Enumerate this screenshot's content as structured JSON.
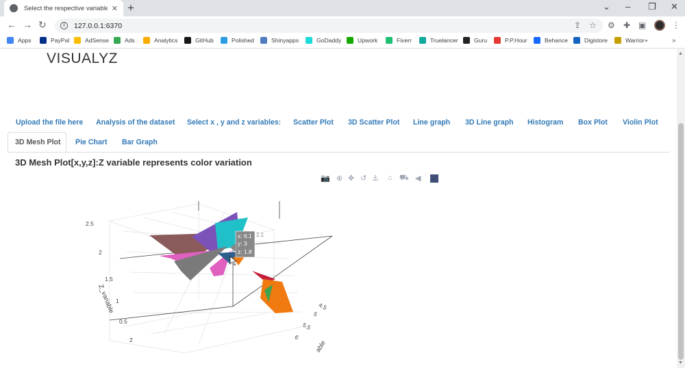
{
  "browser": {
    "tab_title": "Select the respective variables to pl",
    "url": "127.0.0.1:6370",
    "bookmarks": [
      {
        "label": "Apps",
        "icon": "apps-grid-icon",
        "color": "#4285f4"
      },
      {
        "label": "PayPal",
        "icon": "paypal-icon",
        "color": "#003087"
      },
      {
        "label": "AdSense",
        "icon": "adsense-icon",
        "color": "#fbbc04"
      },
      {
        "label": "Ads",
        "icon": "google-ads-icon",
        "color": "#34a853"
      },
      {
        "label": "Analytics",
        "icon": "analytics-icon",
        "color": "#f9ab00"
      },
      {
        "label": "GitHub",
        "icon": "github-icon",
        "color": "#181717"
      },
      {
        "label": "Polished",
        "icon": "polished-icon",
        "color": "#2f9be0"
      },
      {
        "label": "Shinyapps",
        "icon": "shinyapps-icon",
        "color": "#4f7cbf"
      },
      {
        "label": "GoDaddy",
        "icon": "godaddy-icon",
        "color": "#1bdbdb"
      },
      {
        "label": "Upwork",
        "icon": "upwork-icon",
        "color": "#14a800"
      },
      {
        "label": "Fiverr",
        "icon": "fiverr-icon",
        "color": "#1dbf73"
      },
      {
        "label": "Truelancer",
        "icon": "truelancer-icon",
        "color": "#13a89e"
      },
      {
        "label": "Guru",
        "icon": "guru-icon",
        "color": "#222222"
      },
      {
        "label": "P.P.Hour",
        "icon": "pph-icon",
        "color": "#e53935"
      },
      {
        "label": "Behance",
        "icon": "behance-icon",
        "color": "#1769ff"
      },
      {
        "label": "Digistore",
        "icon": "digistore-icon",
        "color": "#1565c0"
      },
      {
        "label": "Warrior+",
        "icon": "warriorplus-icon",
        "color": "#c6a000"
      }
    ],
    "bookmarks_more": "»"
  },
  "app": {
    "brand": "VISUALYZ",
    "tabs": [
      "Upload the file here",
      "Analysis of the dataset",
      "Select x , y and z variables:",
      "Scatter Plot",
      "3D Scatter Plot",
      "Line graph",
      "3D Line graph",
      "Histogram",
      "Box Plot",
      "Violin Plot",
      "3D Mesh Plot",
      "Pie Chart",
      "Bar Graph"
    ],
    "active_tab": "3D Mesh Plot",
    "section_title": "3D Mesh Plot[x,y,z]:Z variable represents color variation"
  },
  "chart_data": {
    "type": "mesh3d",
    "zlabel": "Z_variable",
    "ylabel": "able",
    "z_ticks": [
      "2.5",
      "2",
      "1.5",
      "1",
      "0.5",
      "2"
    ],
    "y_ticks": [
      "4.5",
      "5",
      "5.5",
      "6"
    ],
    "hover": {
      "x": "x: 6.1",
      "y": "y: 3",
      "z": "z: 1.8",
      "side": "2.1"
    },
    "colors": [
      "#8b5a5a",
      "#7b52b8",
      "#20c0c8",
      "#e060c0",
      "#7a7a7a",
      "#f07a10",
      "#c41e3a",
      "#3fa34d",
      "#2c5f8a"
    ]
  },
  "modebar": [
    "camera-icon",
    "zoom-icon",
    "pan-icon",
    "orbit-icon",
    "turntable-icon",
    "home-icon",
    "reset-camera-icon",
    "hover-toggle-icon",
    "plotly-logo-icon"
  ]
}
